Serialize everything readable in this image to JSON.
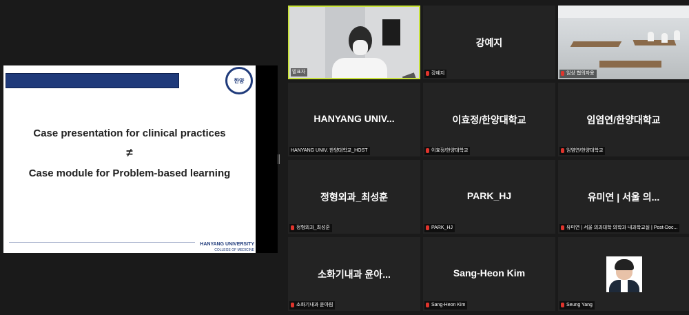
{
  "shared_slide": {
    "line1": "Case presentation  for clinical practices",
    "symbol": "≠",
    "line2": "Case module for Problem-based learning",
    "seal_text": "한양",
    "footer_title": "HANYANG UNIVERSITY",
    "footer_subtitle": "COLLEGE OF MEDICINE"
  },
  "participants": [
    {
      "display": "",
      "label": "발표자",
      "muted": false,
      "type": "video"
    },
    {
      "display": "강예지",
      "label": "강예지",
      "muted": true,
      "type": "name"
    },
    {
      "display": "",
      "label": "임상 협의자용",
      "muted": true,
      "type": "video"
    },
    {
      "display": "HANYANG UNIV...",
      "label": "HANYANG UNIV. 한양대학교_HOST",
      "muted": false,
      "type": "name"
    },
    {
      "display": "이효정/한양대학교",
      "label": "이효정/한양대학교",
      "muted": true,
      "type": "name"
    },
    {
      "display": "임염연/한양대학교",
      "label": "임염연/한양대학교",
      "muted": true,
      "type": "name"
    },
    {
      "display": "정형외과_최성훈",
      "label": "정형외과_최성훈",
      "muted": true,
      "type": "name"
    },
    {
      "display": "PARK_HJ",
      "label": "PARK_HJ",
      "muted": true,
      "type": "name"
    },
    {
      "display": "유미연 | 서울 의...",
      "label": "유미연 | 서울 의과대학 의학과 내과학교실 | Post-Doc...",
      "muted": true,
      "type": "name"
    },
    {
      "display": "소화기내과 윤아...",
      "label": "소화기내과 윤아림",
      "muted": true,
      "type": "name"
    },
    {
      "display": "Sang-Heon Kim",
      "label": "Sang-Heon Kim",
      "muted": true,
      "type": "name"
    },
    {
      "display": "",
      "label": "Seung Yang",
      "muted": true,
      "type": "avatar"
    }
  ],
  "colors": {
    "active_speaker_border": "#c8e23a",
    "muted_icon": "#e0342c",
    "slide_accent": "#1f3a7a"
  }
}
